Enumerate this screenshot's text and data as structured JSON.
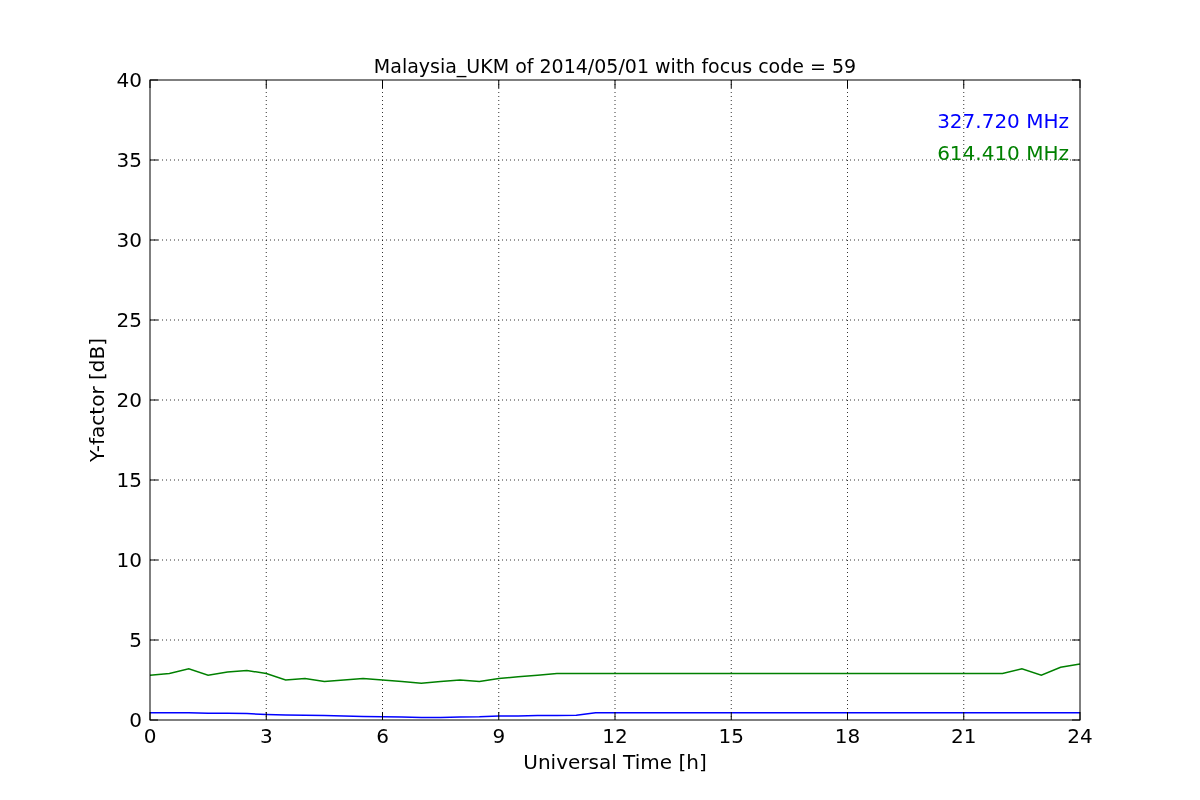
{
  "figure": {
    "chart_data": {
      "type": "line",
      "title": "Malaysia_UKM of 2014/05/01 with focus code = 59",
      "xlabel": "Universal Time [h]",
      "ylabel": "Y-factor [dB]",
      "x": [
        0,
        0.5,
        1,
        1.5,
        2,
        2.5,
        3,
        3.5,
        4,
        4.5,
        5,
        5.5,
        6,
        6.5,
        7,
        7.5,
        8,
        8.5,
        9,
        9.5,
        10,
        10.5,
        11,
        11.5,
        12,
        12.5,
        13,
        13.5,
        14,
        14.5,
        15,
        15.5,
        16,
        16.5,
        17,
        17.5,
        18,
        18.5,
        19,
        19.5,
        20,
        20.5,
        21,
        21.5,
        22,
        22.5,
        23,
        23.5,
        24
      ],
      "series": [
        {
          "name": "327.720 MHz",
          "color": "#0000ff",
          "values": [
            0.45,
            0.45,
            0.45,
            0.42,
            0.42,
            0.4,
            0.35,
            0.32,
            0.3,
            0.28,
            0.25,
            0.22,
            0.2,
            0.18,
            0.15,
            0.15,
            0.18,
            0.2,
            0.25,
            0.25,
            0.28,
            0.28,
            0.3,
            0.45,
            0.45,
            0.45,
            0.45,
            0.45,
            0.45,
            0.45,
            0.45,
            0.45,
            0.45,
            0.45,
            0.45,
            0.45,
            0.45,
            0.45,
            0.45,
            0.45,
            0.45,
            0.45,
            0.45,
            0.45,
            0.45,
            0.45,
            0.45,
            0.45,
            0.45
          ]
        },
        {
          "name": "614.410 MHz",
          "color": "#008000",
          "values": [
            2.8,
            2.9,
            3.2,
            2.8,
            3.0,
            3.1,
            2.9,
            2.5,
            2.6,
            2.4,
            2.5,
            2.6,
            2.5,
            2.4,
            2.3,
            2.4,
            2.5,
            2.4,
            2.6,
            2.7,
            2.8,
            2.9,
            2.9,
            2.9,
            2.9,
            2.9,
            2.9,
            2.9,
            2.9,
            2.9,
            2.9,
            2.9,
            2.9,
            2.9,
            2.9,
            2.9,
            2.9,
            2.9,
            2.9,
            2.9,
            2.9,
            2.9,
            2.9,
            2.9,
            2.9,
            3.2,
            2.8,
            3.3,
            3.5
          ]
        }
      ],
      "grid": true,
      "xlim": [
        0,
        24
      ],
      "ylim": [
        0,
        40
      ],
      "xticks": [
        0,
        3,
        6,
        9,
        12,
        15,
        18,
        21,
        24
      ],
      "yticks": [
        0,
        5,
        10,
        15,
        20,
        25,
        30,
        35,
        40
      ]
    }
  }
}
